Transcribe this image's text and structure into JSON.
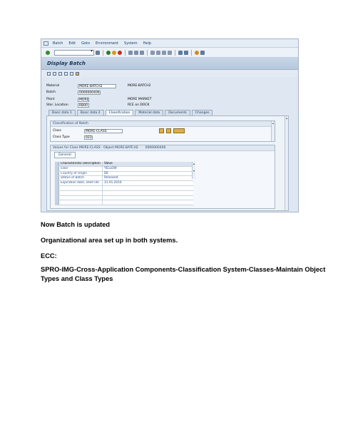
{
  "sap": {
    "menu": [
      "Batch",
      "Edit",
      "Goto",
      "Environment",
      "System",
      "Help"
    ],
    "title": "Display Batch",
    "header_fields": [
      {
        "label": "Material",
        "value": "MORE-BATCH2",
        "desc": "MORE-BATCH2"
      },
      {
        "label": "Batch",
        "value": "0000000406",
        "desc": ""
      },
      {
        "label": "Plant",
        "value": "MORE",
        "desc": "MORE MARKET"
      },
      {
        "label": "Stor. Location",
        "value": "RB00",
        "desc": "RCE on DOCK"
      }
    ],
    "tabs": [
      "Basic data 1",
      "Basic data 2",
      "Classification",
      "Material data",
      "Documents",
      "Changes"
    ],
    "classification": {
      "group_title": "Classification of Batch",
      "class_label": "Class",
      "class_value": "MORE-CLASS",
      "class_type_label": "Class Type",
      "class_type_value": "023"
    },
    "values": {
      "group_title": "Values for Class MORE-CLASS - Object MORE-BATCH2",
      "object_number": "0000000406",
      "subtab": "General",
      "col_char": "Characteristic Description",
      "col_value": "Value",
      "rows": [
        {
          "char": "color",
          "value": "YELLOW"
        },
        {
          "char": "Country of Origin",
          "value": "DE"
        },
        {
          "char": "Status of Batch",
          "value": "Released"
        },
        {
          "char": "Expiration date, shelf life",
          "value": "31.01.2016"
        }
      ]
    },
    "colors": {
      "title_bg": "#b6c8dd",
      "link": "#2a4f8a"
    }
  },
  "document": {
    "line1": "Now Batch is updated",
    "line2": "Organizational area set up in both systems.",
    "line3": "ECC:",
    "line4a": "SPRO-IMG-Cross-Application Components-Classification System-Classes-Maintain Object",
    "line4b": "Types and Class Types"
  }
}
